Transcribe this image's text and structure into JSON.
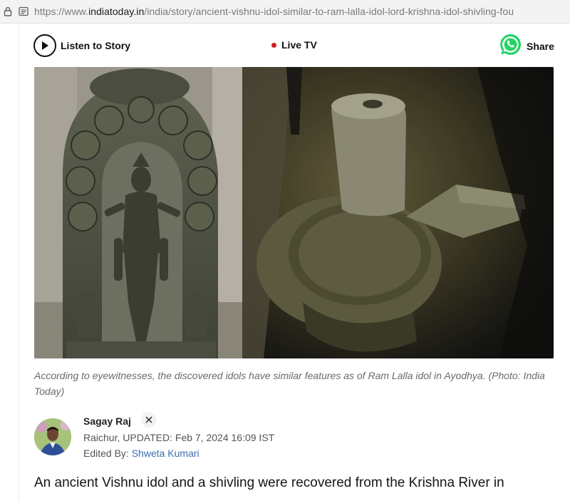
{
  "browser": {
    "url_prefix": "https://www.",
    "url_host": "indiatoday.in",
    "url_path": "/india/story/ancient-vishnu-idol-similar-to-ram-lalla-idol-lord-krishna-idol-shivling-fou"
  },
  "toolbar": {
    "listen_label": "Listen to Story",
    "live_label": "Live TV",
    "share_label": "Share"
  },
  "colors": {
    "live_dot": "#cc1f1f",
    "whatsapp": "#25d366",
    "editor_link": "#3b6db3"
  },
  "hero": {
    "caption": "According to eyewitnesses, the discovered idols have similar features as of Ram Lalla idol in Ayodhya. (Photo: India Today)"
  },
  "author": {
    "name": "Sagay Raj",
    "location": "Raichur,",
    "updated": "UPDATED: Feb 7, 2024 16:09 IST",
    "edited_by_label": "Edited By:",
    "editor": "Shweta Kumari"
  },
  "article": {
    "lead": "An ancient Vishnu idol and a shivling were recovered from the Krishna River in"
  }
}
